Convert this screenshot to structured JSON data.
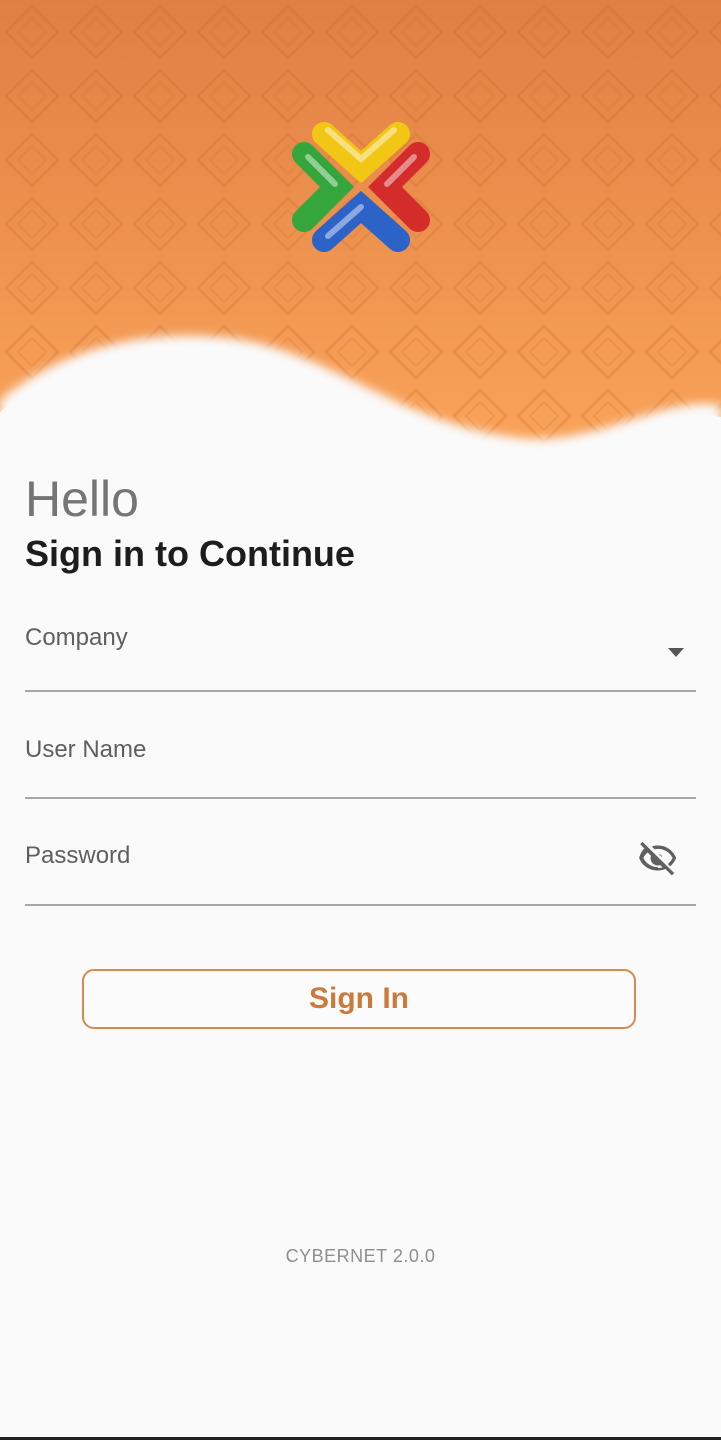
{
  "greeting": "Hello",
  "subtitle": "Sign in to Continue",
  "form": {
    "company_label": "Company",
    "username_label": "User Name",
    "password_label": "Password"
  },
  "signin_label": "Sign In",
  "version": "CYBERNET 2.0.0",
  "colors": {
    "header_top": "#e07f43",
    "header_bottom": "#fba55a",
    "background": "#fafafa",
    "accent": "#c97b3d",
    "logo_yellow": "#f2c614",
    "logo_red": "#d42b2b",
    "logo_green": "#35a63b",
    "logo_blue": "#2d63c7"
  },
  "icons": {
    "logo": "colored-x-logo",
    "company_dropdown": "dropdown-arrow-icon",
    "password_visibility": "eye-off-icon"
  }
}
